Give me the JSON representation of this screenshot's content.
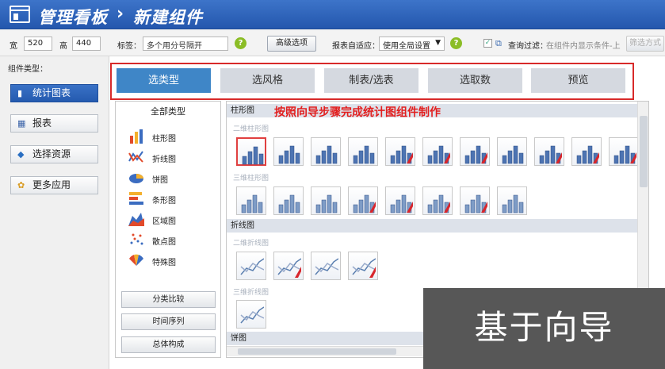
{
  "titlebar": {
    "title": "管理看板",
    "separator": "›",
    "subtitle": "新建组件"
  },
  "toolbar": {
    "width_label": "宽",
    "width_value": "520",
    "height_label": "高",
    "height_value": "440",
    "tag_label": "标签：",
    "tag_value": "多个用分号隔开",
    "help_glyph": "?",
    "advanced_button": "高级选项",
    "fit_label": "报表自适应：",
    "fit_value": "使用全局设置",
    "query_filter_label": "查询过滤：",
    "query_filter_hint": "在组件内显示条件-上",
    "options_button": "筛选方式"
  },
  "sidebar": {
    "header": "组件类型：",
    "items": [
      {
        "label": "统计图表",
        "icon": "chart-icon"
      },
      {
        "label": "报表",
        "icon": "table-icon"
      },
      {
        "label": "选择资源",
        "icon": "resource-icon"
      },
      {
        "label": "更多应用",
        "icon": "apps-icon"
      }
    ]
  },
  "wizard": {
    "steps": [
      "选类型",
      "选风格",
      "制表/选表",
      "选取数",
      "预览"
    ],
    "active": 0
  },
  "instruction": "按照向导步骤完成统计图组件制作",
  "categories": {
    "header": "全部类型",
    "items": [
      "柱形图",
      "折线图",
      "饼图",
      "条形图",
      "区域图",
      "散点图",
      "特殊图"
    ],
    "groups": [
      "分类比较",
      "时间序列",
      "总体构成"
    ]
  },
  "charts": {
    "sections": [
      "柱形图",
      "折线图",
      "饼图"
    ],
    "subs": [
      "二维柱形图",
      "三维柱形图",
      "二维折线图",
      "三维折线图"
    ]
  },
  "overlay": "基于向导",
  "colors": {
    "accent": "#2d63b8",
    "highlight": "#e21e1e",
    "active_step": "#3f86c7"
  }
}
